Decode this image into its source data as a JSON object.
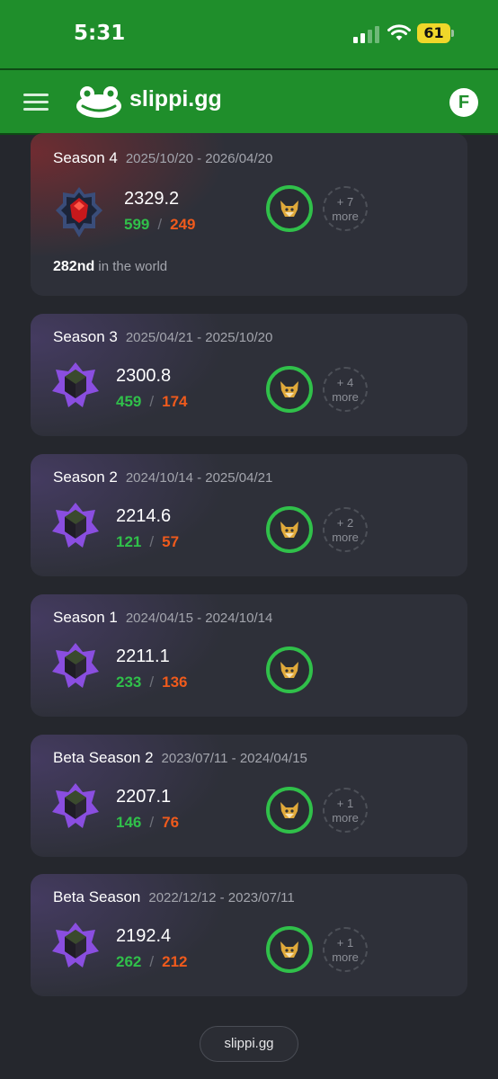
{
  "status_bar": {
    "time": "5:31",
    "battery": "61"
  },
  "header": {
    "brand": "slippi.gg",
    "avatar_initial": "F"
  },
  "seasons": [
    {
      "name": "Season 4",
      "dates": "2025/10/20 - 2026/04/20",
      "rating": "2329.2",
      "wins": "599",
      "losses": "249",
      "more_count": "+ 7",
      "more_label": "more",
      "rank_place": "282nd",
      "rank_suffix": "in the world",
      "rank_icon": "grandmaster-rank-icon"
    },
    {
      "name": "Season 3",
      "dates": "2025/04/21 - 2025/10/20",
      "rating": "2300.8",
      "wins": "459",
      "losses": "174",
      "more_count": "+ 4",
      "more_label": "more",
      "rank_icon": "master-rank-icon"
    },
    {
      "name": "Season 2",
      "dates": "2024/10/14 - 2025/04/21",
      "rating": "2214.6",
      "wins": "121",
      "losses": "57",
      "more_count": "+ 2",
      "more_label": "more",
      "rank_icon": "master-rank-icon"
    },
    {
      "name": "Season 1",
      "dates": "2024/04/15 - 2024/10/14",
      "rating": "2211.1",
      "wins": "233",
      "losses": "136",
      "rank_icon": "master-rank-icon"
    },
    {
      "name": "Beta Season 2",
      "dates": "2023/07/11 - 2024/04/15",
      "rating": "2207.1",
      "wins": "146",
      "losses": "76",
      "more_count": "+ 1",
      "more_label": "more",
      "rank_icon": "master-rank-icon"
    },
    {
      "name": "Beta Season",
      "dates": "2022/12/12 - 2023/07/11",
      "rating": "2192.4",
      "wins": "262",
      "losses": "212",
      "more_count": "+ 1",
      "more_label": "more",
      "rank_icon": "master-rank-icon"
    }
  ],
  "footer": {
    "link": "slippi.gg"
  },
  "colors": {
    "brand_green": "#1f8e2b",
    "wins": "#30c04a",
    "losses": "#ef5a1c",
    "card_bg": "#2e3039"
  }
}
